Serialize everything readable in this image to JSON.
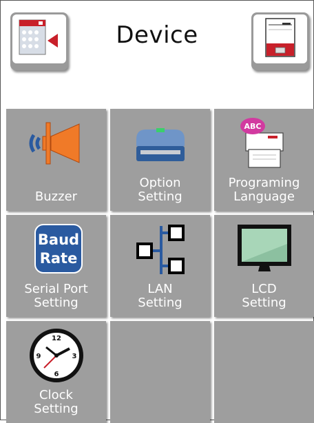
{
  "header": {
    "title": "Device",
    "back_icon": "keypad-back-icon",
    "info_icon": "printer-info-icon"
  },
  "tiles": [
    {
      "label": "Buzzer",
      "icon": "speaker-icon"
    },
    {
      "label": "Option\nSetting",
      "icon": "printer-option-icon"
    },
    {
      "label": "Programing\nLanguage",
      "icon": "abc-printer-icon"
    },
    {
      "label": "Serial Port\nSetting",
      "icon": "baud-rate-icon",
      "icon_text": [
        "Baud",
        "Rate"
      ]
    },
    {
      "label": "LAN\nSetting",
      "icon": "network-icon"
    },
    {
      "label": "LCD\nSetting",
      "icon": "monitor-icon"
    },
    {
      "label": "Clock\nSetting",
      "icon": "clock-icon",
      "clock_numbers": [
        "12",
        "3",
        "6",
        "9"
      ]
    },
    {
      "label": "",
      "icon": ""
    },
    {
      "label": "",
      "icon": ""
    }
  ],
  "colors": {
    "tile": "#9e9e9e",
    "accent_red": "#c8202a",
    "speaker_orange": "#f07a28",
    "blue": "#2a5aa0"
  }
}
